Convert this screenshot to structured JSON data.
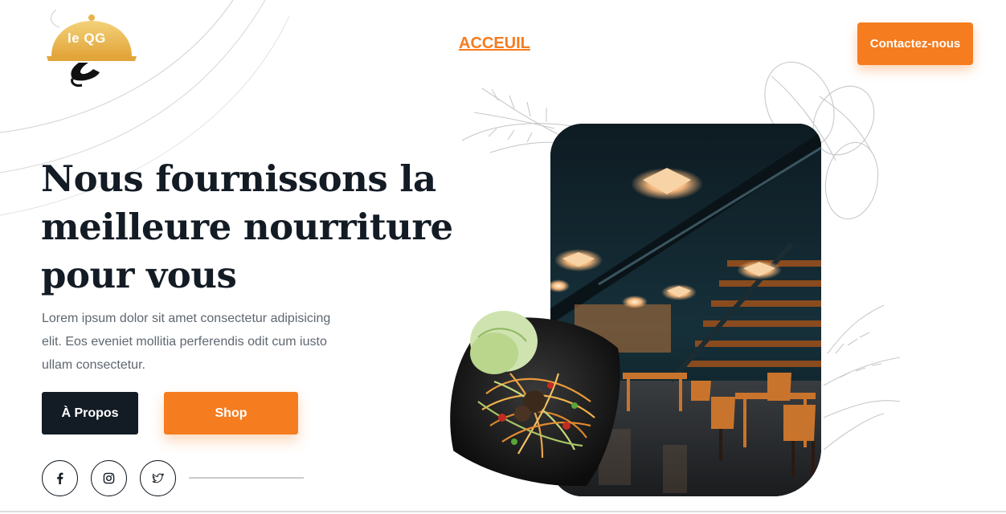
{
  "brand": {
    "logo_text": "le QG",
    "accent": "#f57c1f",
    "dark": "#131b24"
  },
  "nav": {
    "home_label": "ACCEUIL",
    "contact_label": "Contactez-nous"
  },
  "hero": {
    "title": "Nous fournissons la meilleure nourriture pour vous",
    "description": "Lorem ipsum dolor sit amet consectetur adipisicing elit. Eos eveniet mollitia perferendis odit cum iusto ullam consectetur.",
    "about_label": "À Propos",
    "shop_label": "Shop"
  },
  "social": {
    "icons": [
      "facebook-icon",
      "instagram-icon",
      "twitter-icon"
    ]
  },
  "images": {
    "restaurant": "restaurant-interior-photo",
    "plate": "food-plate-photo"
  }
}
